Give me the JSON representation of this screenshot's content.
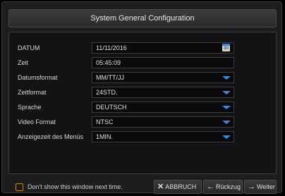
{
  "window": {
    "title": "System General Configuration"
  },
  "fields": [
    {
      "label": "DATUM",
      "value": "11/11/2016",
      "kind": "date",
      "icon": "calendar-icon",
      "icon_text": "30"
    },
    {
      "label": "Zeit",
      "value": "05:45:09",
      "kind": "time"
    },
    {
      "label": "Datumsformat",
      "value": "MM/TT/JJ",
      "kind": "dropdown"
    },
    {
      "label": "Zeitformat",
      "value": "24STD.",
      "kind": "dropdown"
    },
    {
      "label": "Sprache",
      "value": "DEUTSCH",
      "kind": "dropdown"
    },
    {
      "label": "Video Format",
      "value": "NTSC",
      "kind": "dropdown"
    },
    {
      "label": "Anzeigezeit des Menüs",
      "value": "1MIN.",
      "kind": "dropdown"
    }
  ],
  "footer": {
    "checkbox_label": "Don't show this window next time.",
    "checkbox_checked": false,
    "cancel_label": "ABBRUCH",
    "back_label": "Rückzug",
    "next_label": "Weiter"
  },
  "colors": {
    "accent": "#3d86d8",
    "checkbox_border": "#b88a2a"
  }
}
